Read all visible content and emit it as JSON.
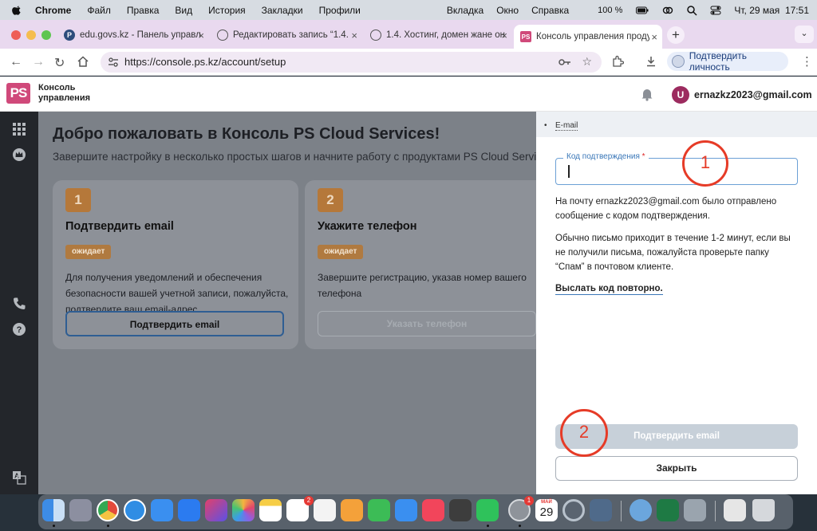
{
  "menubar": {
    "app": "Chrome",
    "items": [
      "Файл",
      "Правка",
      "Вид",
      "История",
      "Закладки",
      "Профили"
    ],
    "right_items": [
      "Вкладка",
      "Окно",
      "Справка"
    ],
    "battery": "100 %",
    "datetime": "Чт, 29 мая  17:51"
  },
  "browser": {
    "tabs": [
      {
        "title": "edu.govs.kz - Панель управл",
        "icon": "letter-p-icon"
      },
      {
        "title": "Редактировать запись “1.4.",
        "icon": "globe-icon"
      },
      {
        "title": "1.4. Хостинг, домен жане он",
        "icon": "globe-icon"
      },
      {
        "title": "Консоль управления продук",
        "icon": "ps-logo-icon",
        "active": true
      }
    ],
    "url": "https://console.ps.kz/account/setup",
    "verify_identity": "Подтвердить личность"
  },
  "header": {
    "logo": "PS",
    "brand_line1": "Консоль",
    "brand_line2": "управления",
    "avatar_letter": "U",
    "email": "ernazkz2023@gmail.com"
  },
  "main": {
    "title": "Добро пожаловать в Консоль PS Cloud Services!",
    "subtitle": "Завершите настройку в несколько простых шагов и начните работу с продуктами PS Cloud Servic",
    "cards": [
      {
        "number": "1",
        "title": "Подтвердить email",
        "status": "ожидает",
        "text": "Для получения уведомлений и обеспечения безопасности вашей учетной записи, пожалуйста, подтвердите ваш email-адрес",
        "button": "Подтвердить email"
      },
      {
        "number": "2",
        "title": "Укажите телефон",
        "status": "ожидает",
        "text": "Завершите регистрацию, указав номер вашего телефона",
        "button": "Указать телефон"
      }
    ]
  },
  "panel": {
    "breadcrumb_dot": "•",
    "breadcrumb": "E-mail",
    "code_label": "Код подтверждения",
    "required_mark": "*",
    "sent_text": "На почту ernazkz2023@gmail.com было отправлено сообщение с кодом подтверждения.",
    "info_text": "Обычно письмо приходит в течение 1-2 минут, если вы не получили письма, пожалуйста проверьте папку “Спам” в почтовом клиенте.",
    "resend": "Выслать код повторно.",
    "confirm_button": "Подтвердить email",
    "close_button": "Закрыть"
  },
  "annotations": [
    "1",
    "2"
  ],
  "dock": {
    "reminders_badge": "2",
    "settings_badge": "1",
    "calendar_month": "МАЙ",
    "calendar_day": "29"
  },
  "colors": {
    "brand": "#d0497a",
    "annotation": "#e63b27",
    "accent_blue": "#3a77b8",
    "pending_badge": "#b07a40"
  }
}
